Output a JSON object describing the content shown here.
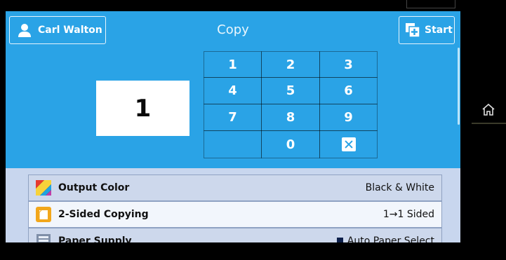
{
  "header": {
    "user_label": "Carl Walton",
    "title": "Copy",
    "start_label": "Start"
  },
  "quantity": {
    "value": "1"
  },
  "keypad": {
    "keys": [
      "1",
      "2",
      "3",
      "4",
      "5",
      "6",
      "7",
      "8",
      "9",
      "0"
    ]
  },
  "settings": {
    "rows": [
      {
        "label": "Output Color",
        "value": "Black & White"
      },
      {
        "label": "2-Sided Copying",
        "value": "1→1 Sided"
      },
      {
        "label": "Paper Supply",
        "value": "Auto Paper Select"
      }
    ]
  },
  "colors": {
    "panel_blue": "#2aa3e6",
    "list_bg": "#c8d6ee"
  }
}
